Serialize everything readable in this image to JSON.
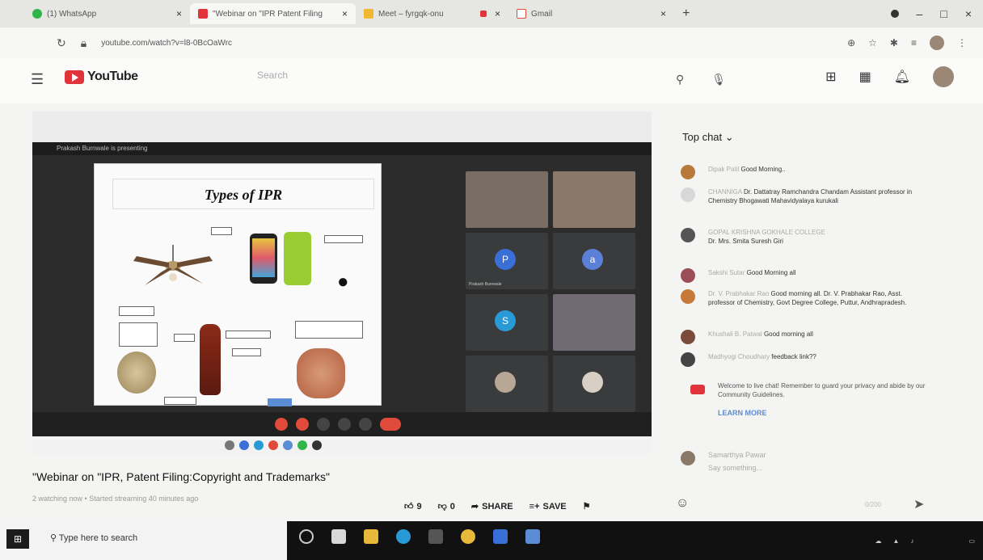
{
  "browser": {
    "tabs": [
      {
        "title": "(1) WhatsApp",
        "favicon_color": "#2fb54a",
        "active": false
      },
      {
        "title": "\"Webinar on \"IPR Patent Filing",
        "favicon_color": "#e0343a",
        "active": true
      },
      {
        "title": "Meet – fyrgqk-onu",
        "favicon_color": "#f1b731",
        "active": false
      },
      {
        "title": "Gmail",
        "favicon_color": "#e04a3a",
        "active": false
      }
    ],
    "new_tab": "+",
    "url": "youtube.com/watch?v=l8-0BcOaWrc",
    "window_controls": {
      "minimize": "–",
      "maximize": "□",
      "close": "×"
    }
  },
  "youtube": {
    "logo_text": "YouTube",
    "search_placeholder": "Search"
  },
  "video": {
    "slide_title": "Types of IPR",
    "meet_bar_text": "Prakash Burnwale is presenting",
    "participants": [
      {
        "type": "camera",
        "name": ""
      },
      {
        "type": "camera",
        "name": ""
      },
      {
        "type": "avatar",
        "letter": "P",
        "color": "#3a6fd8",
        "name": "Prakash Burnwale"
      },
      {
        "type": "avatar",
        "letter": "a",
        "color": "#5c7fd8",
        "name": ""
      },
      {
        "type": "avatar",
        "letter": "S",
        "color": "#2a9ad6",
        "name": ""
      },
      {
        "type": "camera",
        "name": ""
      },
      {
        "type": "photo",
        "name": ""
      },
      {
        "type": "photo",
        "name": ""
      }
    ]
  },
  "title": "\"Webinar on \"IPR, Patent Filing:Copyright and Trademarks\"",
  "meta": "2 watching now • Started streaming 40 minutes ago",
  "actions": {
    "like_count": "9",
    "dislike_count": "0",
    "share": "SHARE",
    "save": "SAVE"
  },
  "chat": {
    "header": "Top chat",
    "messages": [
      {
        "author": "Dipak Patil",
        "text": "Good Morning..",
        "avatar_color": "#b87a3a"
      },
      {
        "author": "CHANNIGA",
        "text": "Dr. Dattatray Ramchandra Chandam Assistant professor in Chemistry Bhogawati Mahavidyalaya kurukali",
        "avatar_color": "#d8d8d8"
      },
      {
        "author": "GOPAL KRISHNA GOKHALE COLLEGE",
        "text": "Dr. Mrs. Smita Suresh Giri",
        "avatar_color": "#555555"
      },
      {
        "author": "Sakshi Sutar",
        "text": "Good Morning all",
        "avatar_color": "#9c4e58"
      },
      {
        "author": "Dr. V. Prabhakar Rao",
        "text": "Good morning all. Dr. V. Prabhakar Rao, Asst. professor of Chemistry, Govt Degree College, Puttur, Andhrapradesh.",
        "avatar_color": "#c57a3a"
      },
      {
        "author": "Khushali B. Patwal",
        "text": "Good morning all",
        "avatar_color": "#7a4a3a"
      },
      {
        "author": "Madhyogi Choudhary",
        "text": "feedback link??",
        "avatar_color": "#444444"
      }
    ],
    "welcome": "Welcome to live chat! Remember to guard your privacy and abide by our Community Guidelines.",
    "learn_more": "LEARN MORE",
    "input_user": "Samarthya Pawar",
    "input_placeholder": "Say something...",
    "counter": "0/200"
  },
  "taskbar": {
    "search": "Type here to search"
  }
}
